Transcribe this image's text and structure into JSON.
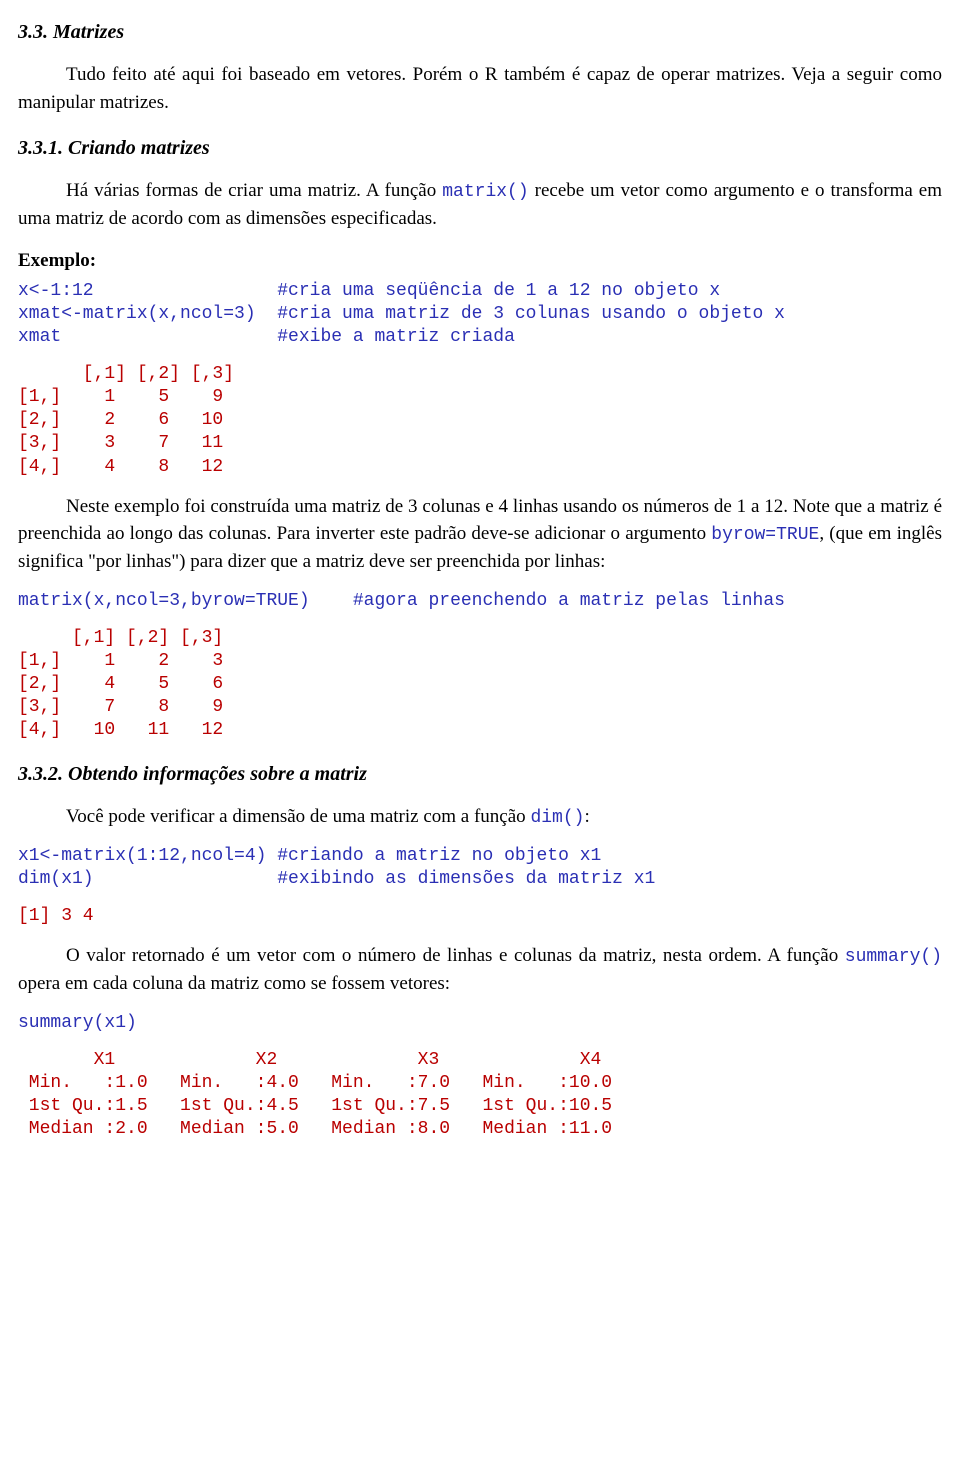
{
  "section33": {
    "heading": "3.3. Matrizes",
    "p1_a": "Tudo feito até aqui foi baseado em vetores. Porém o R também é capaz de operar matrizes. Veja a seguir como manipular matrizes."
  },
  "section331": {
    "heading": "3.3.1. Criando matrizes",
    "p1_a": "Há várias formas de criar uma matriz. A função ",
    "p1_code": "matrix()",
    "p1_b": " recebe um vetor como argumento e o transforma em uma matriz de acordo com as dimensões especificadas.",
    "example_label": "Exemplo:",
    "code1_l1": "x<-1:12                 #cria uma seqüência de 1 a 12 no objeto x",
    "code1_l2": "xmat<-matrix(x,ncol=3)  #cria uma matriz de 3 colunas usando o objeto x",
    "code1_l3": "xmat                    #exibe a matriz criada",
    "out1": "      [,1] [,2] [,3]\n[1,]    1    5    9\n[2,]    2    6   10\n[3,]    3    7   11\n[4,]    4    8   12",
    "p2_a": "Neste exemplo foi construída uma matriz de 3 colunas e 4 linhas usando os números de 1 a 12. Note que a matriz é preenchida ao longo das colunas. Para inverter este padrão deve-se adicionar o argumento ",
    "p2_code": "byrow=TRUE",
    "p2_b": ", (que em inglês significa \"por linhas\") para dizer que a matriz deve ser preenchida por linhas:",
    "code2": "matrix(x,ncol=3,byrow=TRUE)    #agora preenchendo a matriz pelas linhas",
    "out2": "     [,1] [,2] [,3]\n[1,]    1    2    3\n[2,]    4    5    6\n[3,]    7    8    9\n[4,]   10   11   12"
  },
  "section332": {
    "heading": "3.3.2. Obtendo informações sobre a matriz",
    "p1_a": "Você pode verificar a dimensão de uma matriz com a função ",
    "p1_code": "dim()",
    "p1_b": ":",
    "code1_l1": "x1<-matrix(1:12,ncol=4) #criando a matriz no objeto x1",
    "code1_l2": "dim(x1)                 #exibindo as dimensões da matriz x1",
    "out1": "[1] 3 4",
    "p2_a": "O valor retornado é um vetor com o número de linhas e colunas da matriz, nesta ordem. A função ",
    "p2_code": "summary()",
    "p2_b": " opera em cada coluna da matriz como se fossem vetores:",
    "code2": "summary(x1)",
    "out2": "       X1             X2             X3             X4\n Min.   :1.0   Min.   :4.0   Min.   :7.0   Min.   :10.0\n 1st Qu.:1.5   1st Qu.:4.5   1st Qu.:7.5   1st Qu.:10.5\n Median :2.0   Median :5.0   Median :8.0   Median :11.0"
  }
}
